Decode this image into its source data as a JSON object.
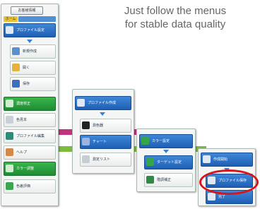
{
  "caption": {
    "line1": "Just follow the menus",
    "line2": "for stable data quality"
  },
  "sidebar": {
    "top_button": "お客様情報",
    "tab_label": "ホーム",
    "items": [
      {
        "label": "プロファイル設定",
        "icon": "printer-icon"
      },
      {
        "label": "新規作成",
        "icon": "document-icon"
      },
      {
        "label": "開く",
        "icon": "folder-icon"
      },
      {
        "label": "保存",
        "icon": "save-icon"
      },
      {
        "label": "濃度校正",
        "icon": "color-patch-icon"
      },
      {
        "label": "色見本",
        "icon": "swatch-icon"
      },
      {
        "label": "プロファイル編集",
        "icon": "pencil-icon"
      },
      {
        "label": "ヘルプ",
        "icon": "person-icon"
      },
      {
        "label": "カラー調整",
        "icon": "color-adjust-icon"
      },
      {
        "label": "色差評価",
        "icon": "evaluate-icon"
      }
    ]
  },
  "panel2": {
    "items": [
      {
        "label": "プロファイル作成",
        "icon": "printer-icon"
      },
      {
        "label": "測色器",
        "icon": "device-icon"
      },
      {
        "label": "チャート",
        "icon": "chart-icon"
      },
      {
        "label": "測定リスト",
        "icon": "list-icon"
      }
    ]
  },
  "panel3": {
    "items": [
      {
        "label": "カラー設定",
        "icon": "color-icon"
      },
      {
        "label": "ターゲット設定",
        "icon": "target-icon"
      },
      {
        "label": "階調補正",
        "icon": "gradation-icon"
      }
    ]
  },
  "panel4": {
    "items": [
      {
        "label": "作成開始",
        "icon": "gear-icon"
      },
      {
        "label": "プロファイル保存",
        "icon": "save-icon"
      },
      {
        "label": "完了",
        "icon": "check-icon"
      }
    ]
  },
  "colors": {
    "connector_magenta": "#c2337e",
    "connector_green": "#7dbb3f",
    "highlight_ring": "#d8141d",
    "menu_blue": "#1e5fb4",
    "menu_green": "#1f8c34"
  }
}
